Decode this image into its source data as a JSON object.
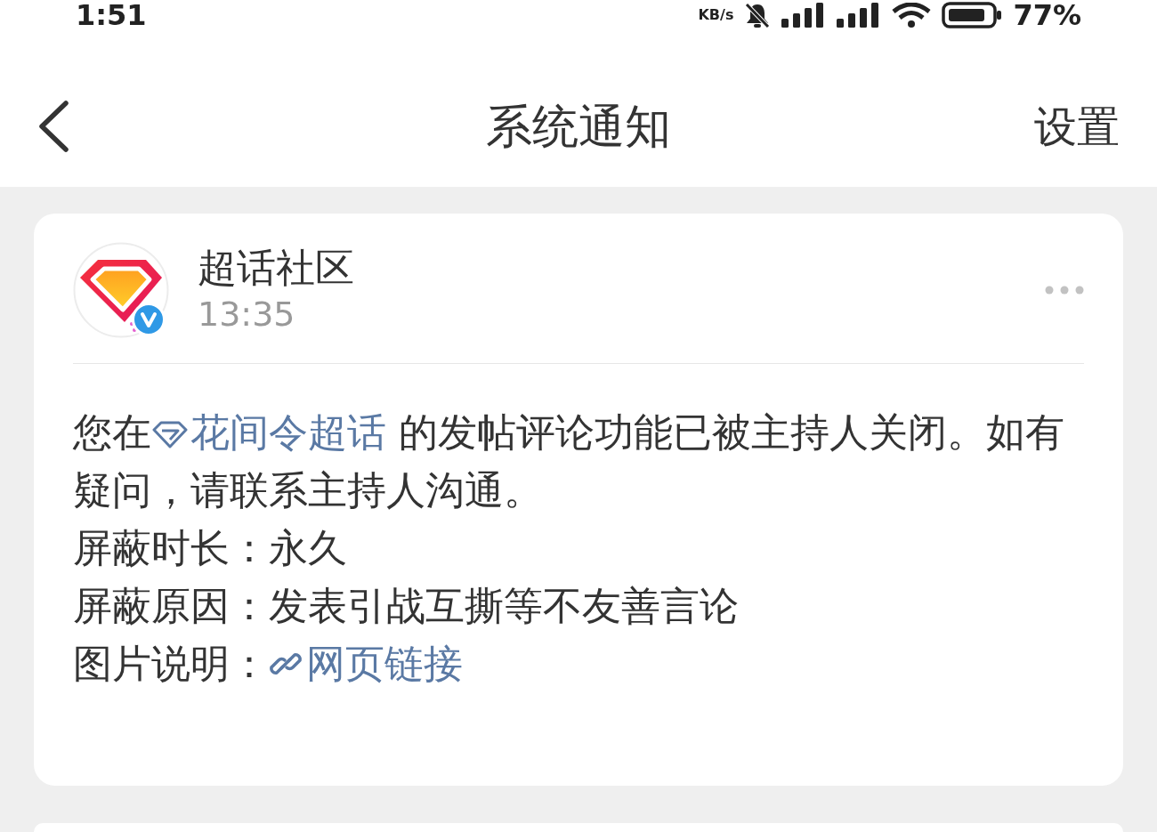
{
  "status_bar": {
    "time": "1:51",
    "network_speed": "KB/s",
    "battery": "77%"
  },
  "header": {
    "title": "系统通知",
    "action": "设置"
  },
  "notifications": [
    {
      "sender": "超话社区",
      "verified": true,
      "time": "13:35",
      "message": {
        "before": "您在",
        "topic": "花间令超话",
        "after": " 的发帖评论功能已被主持人关闭。如有疑问，请联系主持人沟通。"
      },
      "details": [
        {
          "kind": "text",
          "label": "屏蔽时长：",
          "value": "永久"
        },
        {
          "kind": "text",
          "label": "屏蔽原因：",
          "value": "发表引战互撕等不友善言论"
        },
        {
          "kind": "link",
          "label": "图片说明：",
          "value": "网页链接"
        }
      ]
    }
  ]
}
